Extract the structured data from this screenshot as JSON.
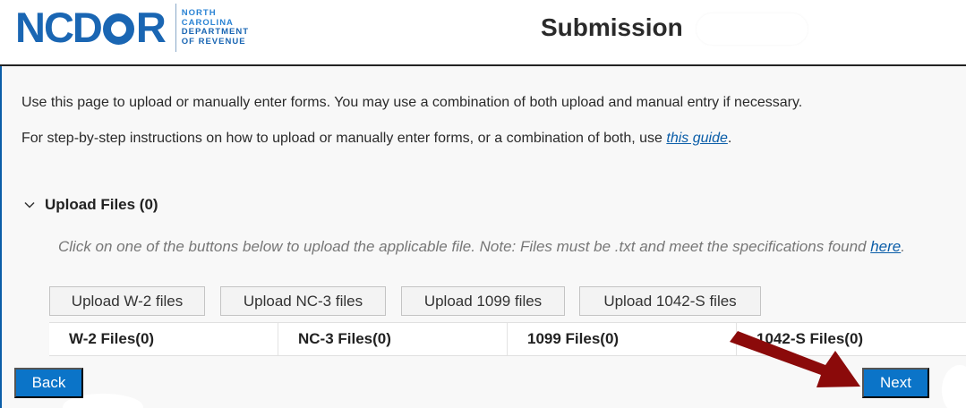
{
  "header": {
    "logo_text": "NCDOR",
    "logo_lines": [
      "NORTH",
      "CAROLINA",
      "DEPARTMENT",
      "OF REVENUE"
    ],
    "title": "Submission"
  },
  "intro": {
    "line1": "Use this page to upload or manually enter forms. You may use a combination of both upload and manual entry if necessary.",
    "line2_before": "For step-by-step instructions on how to upload or manually enter forms, or a combination of both, use ",
    "line2_link": "this guide",
    "line2_after": "."
  },
  "upload_section": {
    "title": "Upload Files (0)",
    "note_before": "Click on one of the buttons below to upload the applicable file. Note: Files must be .txt and meet the specifications found ",
    "note_link": "here",
    "note_after": ".",
    "buttons": [
      "Upload W-2 files",
      "Upload NC-3 files",
      "Upload 1099 files",
      "Upload 1042-S files"
    ],
    "file_counts": [
      "W-2 Files(0)",
      "NC-3 Files(0)",
      "1099 Files(0)",
      "1042-S Files(0)"
    ]
  },
  "footer": {
    "back_label": "Back",
    "next_label": "Next"
  },
  "colors": {
    "brand_blue": "#1a66b3",
    "button_blue": "#0b74c8",
    "link_blue": "#0a5da8",
    "arrow_red": "#8b0a0a"
  }
}
